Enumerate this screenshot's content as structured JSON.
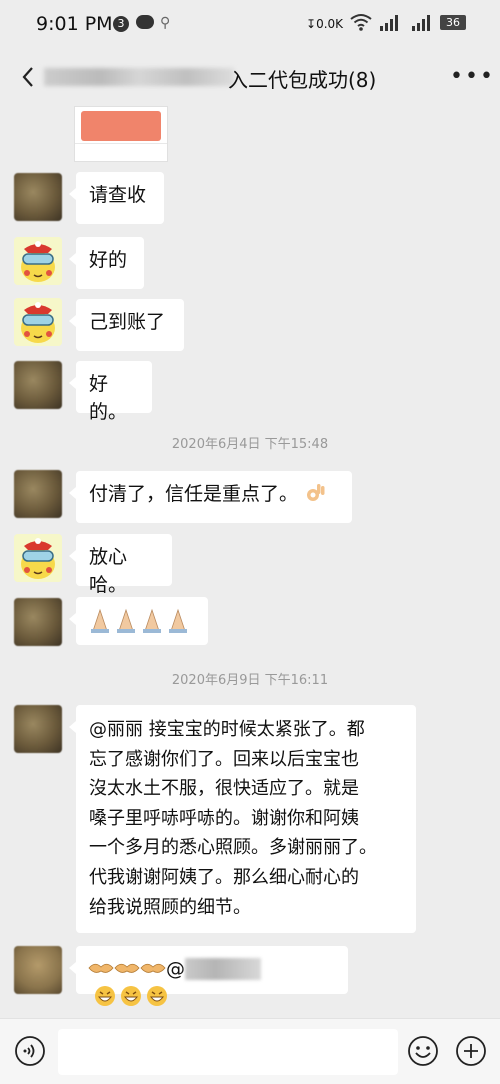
{
  "status_bar": {
    "time": "9:01 PM",
    "notification_count": "3",
    "net_speed": "0.0K",
    "battery": "36"
  },
  "header": {
    "title": "入二代包成功(8)",
    "more_icon": "more-dots-icon",
    "back_icon": "back-chevron-icon"
  },
  "messages": [
    {
      "text": "请查收"
    },
    {
      "text": "好的"
    },
    {
      "text": "己到账了"
    },
    {
      "text": "好的。"
    },
    {
      "timestamp": "2020年6月4日 下午15:48"
    },
    {
      "text": "付清了，信任是重点了。"
    },
    {
      "text": "放心哈。"
    },
    {
      "emoji": "praying-hands-icon"
    },
    {
      "timestamp": "2020年6月9日 下午16:11"
    },
    {
      "text": "@丽丽  接宝宝的时候太紧张了。都忘了感谢你们了。回来以后宝宝也沒太水土不服，很快适应了。就是嗓子里呼哧呼哧的。谢谢你和阿姨一个多月的悉心照顾。多谢丽丽了。代我谢谢阿姨了。那么细心耐心的给我说照顾的细节。"
    },
    {
      "text_prefix": "@",
      "emoji": "handshake-icon grin-icon"
    }
  ],
  "long_message_lines": [
    "@丽丽  接宝宝的时候太紧张了。都",
    "忘了感谢你们了。回来以后宝宝也",
    "沒太水土不服，很快适应了。就是",
    "嗓子里呼哧呼哧的。谢谢你和阿姨",
    "一个多月的悉心照顾。多谢丽丽了。",
    "代我谢谢阿姨了。那么细心耐心的",
    "给我说照顾的细节。"
  ],
  "input_bar": {
    "voice_icon": "voice-icon",
    "emoji_icon": "smiley-icon",
    "plus_icon": "plus-icon"
  },
  "colors": {
    "background": "#ededed",
    "bubble": "#ffffff",
    "timestamp_text": "#999999"
  }
}
